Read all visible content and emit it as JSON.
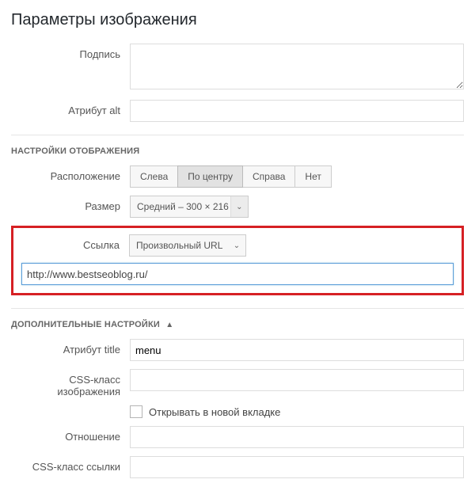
{
  "page_title": "Параметры изображения",
  "labels": {
    "caption": "Подпись",
    "alt": "Атрибут alt",
    "align": "Расположение",
    "size": "Размер",
    "link": "Ссылка",
    "title_attr": "Атрибут title",
    "img_css": "CSS-класс изображения",
    "new_tab": "Открывать в новой вкладке",
    "rel": "Отношение",
    "link_css": "CSS-класс ссылки"
  },
  "sections": {
    "display": "НАСТРОЙКИ ОТОБРАЖЕНИЯ",
    "advanced": "ДОПОЛНИТЕЛЬНЫЕ НАСТРОЙКИ"
  },
  "align_options": {
    "left": "Слева",
    "center": "По центру",
    "right": "Справа",
    "none": "Нет",
    "active": "center"
  },
  "size_select": {
    "value": "Средний – 300 × 216"
  },
  "link_select": {
    "value": "Произвольный URL"
  },
  "link_url": "http://www.bestseoblog.ru/",
  "values": {
    "caption": "",
    "alt": "",
    "title_attr": "menu",
    "img_css": "",
    "rel": "",
    "link_css": ""
  },
  "new_tab_checked": false,
  "icons": {
    "caret_up": "▲",
    "chev_down": "⌄"
  }
}
